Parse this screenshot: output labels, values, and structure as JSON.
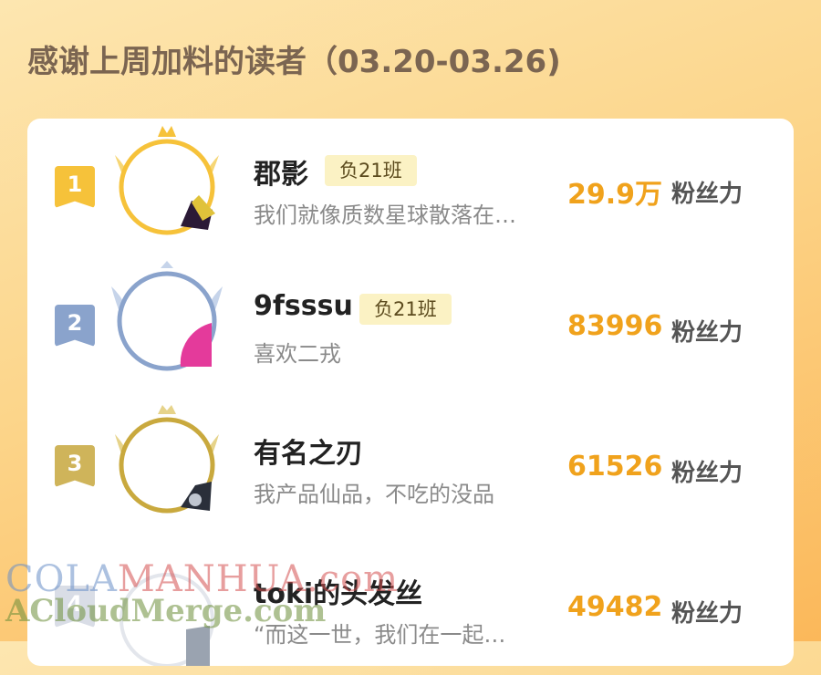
{
  "header": {
    "title": "感谢上周加料的读者（03.20-03.26)"
  },
  "leaderboard": [
    {
      "rank": "1",
      "name": "郡影",
      "tag": "负21班",
      "bio": "我们就像质数星球散落在…",
      "score": "29.9万",
      "unit": "粉丝力"
    },
    {
      "rank": "2",
      "name": "9fsssu",
      "tag": "负21班",
      "bio": "喜欢二戎",
      "score": "83996",
      "unit": "粉丝力"
    },
    {
      "rank": "3",
      "name": "有名之刃",
      "tag": "",
      "bio": "我产品仙品，不吃的没品",
      "score": "61526",
      "unit": "粉丝力"
    },
    {
      "rank": "4",
      "name": "toki的头发丝",
      "tag": "",
      "bio": "“而这一世，我们在一起…",
      "score": "49482",
      "unit": "粉丝力"
    }
  ],
  "watermark": {
    "line1_part1": "COLA",
    "line1_part2": "MANHUA",
    "line1_part3": ".com",
    "line2": "ACloudMerge.com"
  },
  "colors": {
    "gold": "#f0a21c",
    "rank1": "#f6c23a",
    "rank2": "#8aa3cc",
    "rank3": "#cfb45a",
    "rank4": "#d9dde6"
  }
}
